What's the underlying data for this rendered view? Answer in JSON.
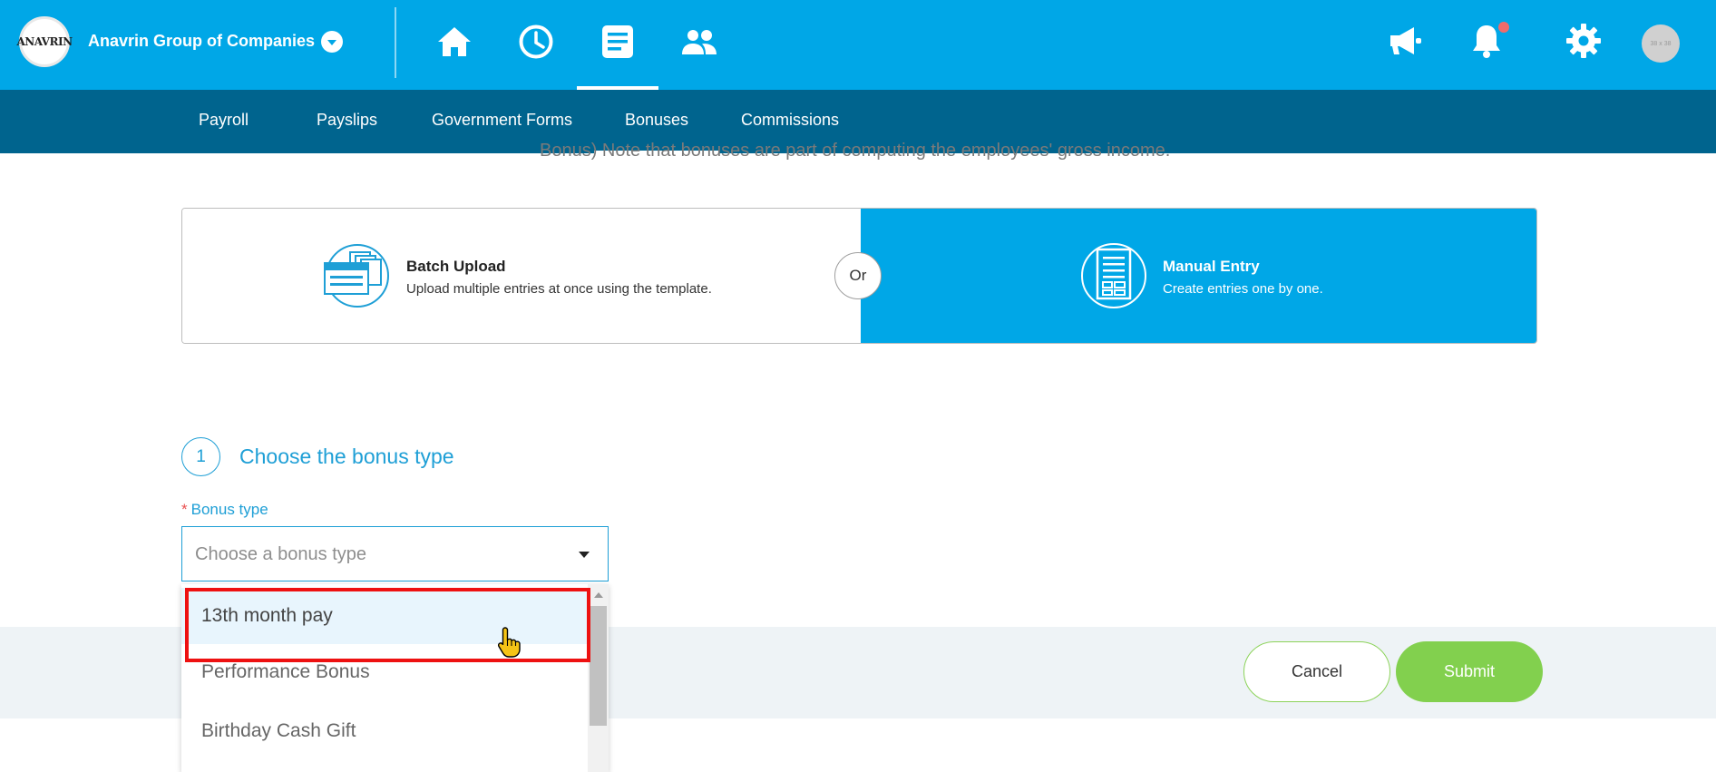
{
  "header": {
    "logo_text": "ANAVRIN",
    "company_name": "Anavrin Group of Companies",
    "nav_icons": [
      "home-icon",
      "clock-icon",
      "document-icon",
      "people-icon"
    ],
    "active_nav": "document-icon",
    "right_icons": [
      "megaphone-icon",
      "bell-icon",
      "gear-icon"
    ],
    "avatar_text": "38 x 38",
    "colors": {
      "primary": "#00a7e7",
      "subnav": "#00648e",
      "notification": "#f26b6b"
    }
  },
  "subnav": {
    "items": [
      "Payroll",
      "Payslips",
      "Government Forms",
      "Bonuses",
      "Commissions"
    ],
    "active": "Bonuses"
  },
  "intro_text": "Bonus) Note that bonuses are part of computing the employees' gross income.",
  "upload_choice": {
    "batch": {
      "title": "Batch Upload",
      "description": "Upload multiple entries at once using the template."
    },
    "or_label": "Or",
    "manual": {
      "title": "Manual Entry",
      "description": "Create entries one by one.",
      "selected": true
    }
  },
  "step": {
    "number": "1",
    "title": "Choose the bonus type",
    "field_label": "Bonus type",
    "required_mark": "*",
    "placeholder": "Choose a bonus type"
  },
  "dropdown": {
    "options": [
      "13th month pay",
      "Performance Bonus",
      "Birthday Cash Gift"
    ],
    "hovered": "13th month pay"
  },
  "actions": {
    "cancel_label": "Cancel",
    "submit_label": "Submit",
    "submit_color": "#82d04e"
  }
}
